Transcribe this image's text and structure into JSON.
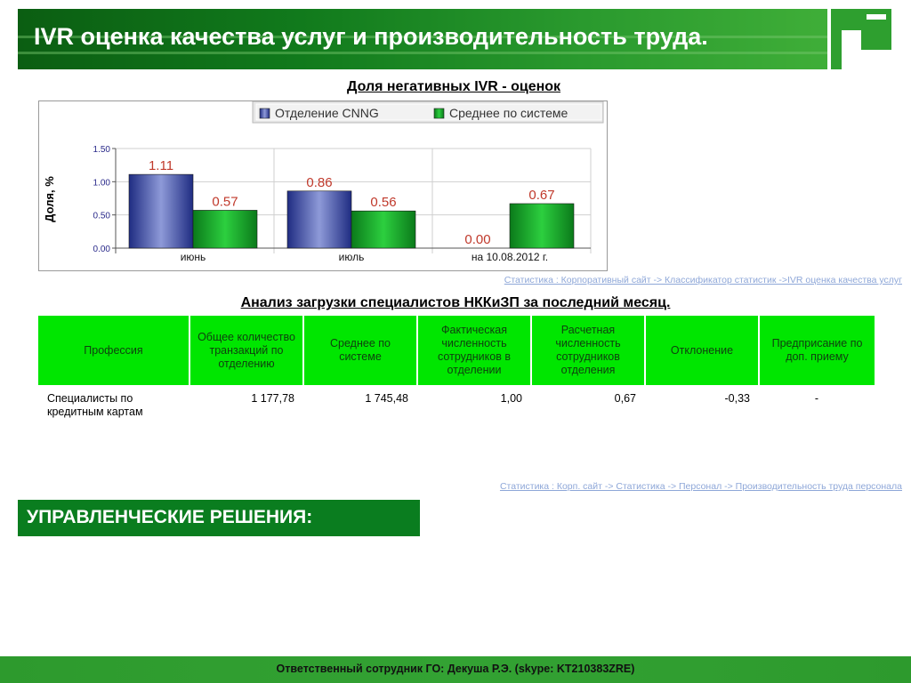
{
  "header": {
    "title": "IVR оценка качества услуг и производительность труда."
  },
  "chart_title": "Доля негативных IVR - оценок",
  "chart_data": {
    "type": "bar",
    "title": "Доля негативных IVR - оценок",
    "ylabel": "Доля, %",
    "xlabel": "",
    "categories": [
      "июнь",
      "июль",
      "на 10.08.2012 г."
    ],
    "series": [
      {
        "name": "Отделение CNNG",
        "values": [
          1.11,
          0.86,
          0.0
        ],
        "labels": [
          "1.11",
          "0.86",
          "0.00"
        ],
        "color": "#2f3f9e"
      },
      {
        "name": "Среднее по системе",
        "values": [
          0.57,
          0.56,
          0.67
        ],
        "labels": [
          "0.57",
          "0.56",
          "0.67"
        ],
        "color": "#17a82a"
      }
    ],
    "ylim": [
      0,
      1.5
    ],
    "yticks": [
      "0.00",
      "0.50",
      "1.00",
      "1.50"
    ],
    "grid": true,
    "legend_position": "top"
  },
  "source_link_1": "Статистика : Корпоративный сайт -> Классификатор статистик ->IVR оценка качества услуг",
  "table_title": "Анализ загрузки специалистов НККиЗП за последний месяц.",
  "table": {
    "headers": [
      "Профессия",
      "Общее количество транзакций по отделению",
      "Среднее по системе",
      "Фактическая численность сотрудников в отделении",
      "Расчетная численность сотрудников отделения",
      "Отклонение",
      "Предприсание по доп. приему"
    ],
    "rows": [
      [
        "Специалисты по кредитным картам",
        "1 177,78",
        "1 745,48",
        "1,00",
        "0,67",
        "-0,33",
        "-"
      ]
    ]
  },
  "source_link_2": "Статистика : Корп. сайт -> Статистика -> Персонал -> Производительность труда персонала",
  "decision_title": "УПРАВЛЕНЧЕСКИЕ РЕШЕНИЯ:",
  "footer": "Ответственный сотрудник ГО: Декуша Р.Э. (skype: KT210383ZRE)"
}
